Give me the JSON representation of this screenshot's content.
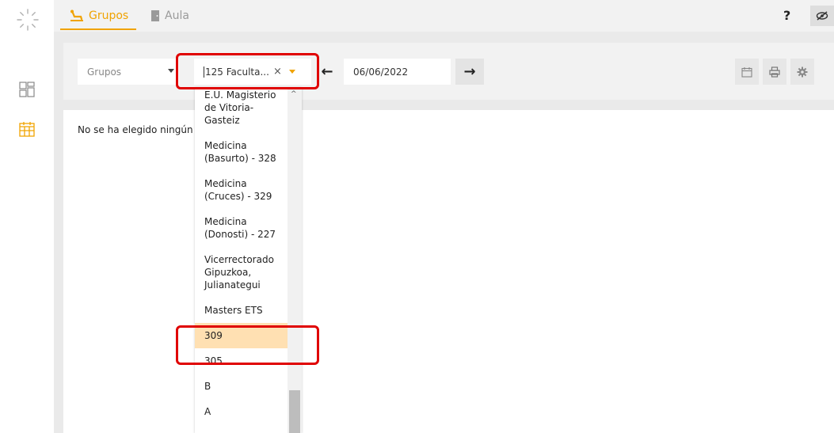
{
  "tabs": [
    {
      "label": "Grupos",
      "icon": "chair-icon",
      "active": true
    },
    {
      "label": "Aula",
      "icon": "door-icon",
      "active": false
    }
  ],
  "topbar": {
    "help_label": "?",
    "toggle_icon": "eye-slash-icon"
  },
  "toolbar": {
    "grupos_select_value": "Grupos",
    "facultad_select_value": "125 Faculta...",
    "clear_glyph": "×",
    "prev_glyph": "←",
    "next_glyph": "→",
    "date_value": "06/06/2022",
    "tools": [
      "calendar-icon",
      "print-icon",
      "gear-icon"
    ]
  },
  "main": {
    "message": "No se ha elegido ningún e"
  },
  "dropdown": {
    "items": [
      {
        "label": "E.U. Magisterio de Vitoria-Gasteiz",
        "selected": false
      },
      {
        "label": "Medicina (Basurto) - 328",
        "selected": false
      },
      {
        "label": "Medicina (Cruces) - 329",
        "selected": false
      },
      {
        "label": "Medicina (Donosti) - 227",
        "selected": false
      },
      {
        "label": "Vicerrectorado Gipuzkoa, Julianategui",
        "selected": false
      },
      {
        "label": "Masters ETS",
        "selected": false
      },
      {
        "label": "309",
        "selected": true
      },
      {
        "label": "305",
        "selected": false
      },
      {
        "label": "B",
        "selected": false
      },
      {
        "label": "A",
        "selected": false
      }
    ],
    "scroll_up_glyph": "^"
  },
  "colors": {
    "accent": "#f0a300",
    "highlight": "#ffe0b2",
    "annotation": "#e00000"
  }
}
